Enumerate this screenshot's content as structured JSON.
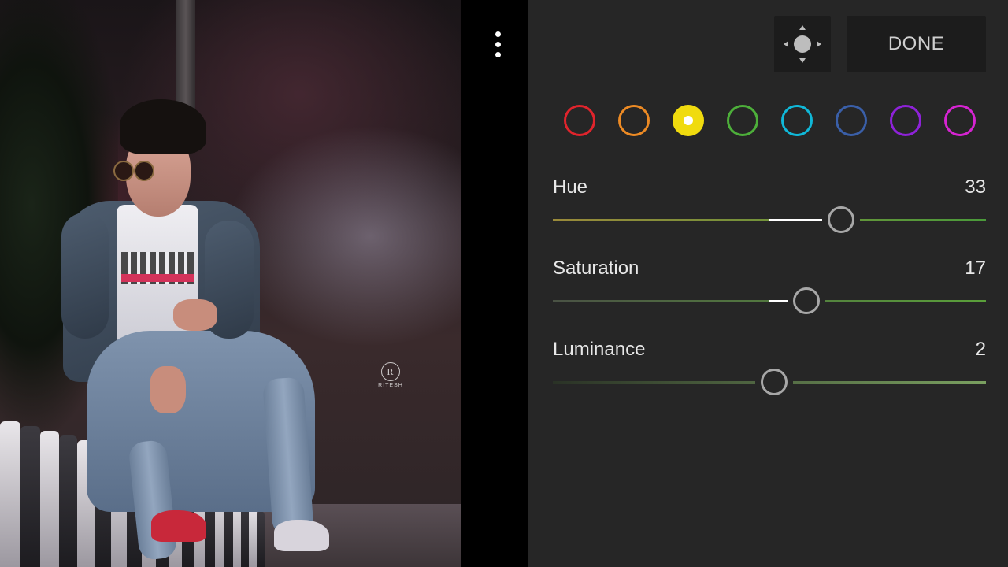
{
  "toolbar": {
    "more_icon": "more-vertical-icon",
    "move_icon": "move-target-icon",
    "done_label": "DONE"
  },
  "photo": {
    "watermark_letter": "R",
    "watermark_text": "RITESH"
  },
  "color_swatches": [
    {
      "name": "red",
      "color": "#e0242c",
      "selected": false
    },
    {
      "name": "orange",
      "color": "#ec8a24",
      "selected": false
    },
    {
      "name": "yellow",
      "color": "#f0db0e",
      "selected": true
    },
    {
      "name": "green",
      "color": "#4daf3a",
      "selected": false
    },
    {
      "name": "aqua",
      "color": "#10b8d8",
      "selected": false
    },
    {
      "name": "blue",
      "color": "#3a5fa8",
      "selected": false
    },
    {
      "name": "purple",
      "color": "#8e22d8",
      "selected": false
    },
    {
      "name": "magenta",
      "color": "#d624d2",
      "selected": false
    }
  ],
  "sliders": {
    "hue": {
      "label": "Hue",
      "value": "33",
      "min": -100,
      "max": 100,
      "num": 33,
      "gradient": [
        "#9a8a3a",
        "#4a9a3a"
      ]
    },
    "saturation": {
      "label": "Saturation",
      "value": "17",
      "min": -100,
      "max": 100,
      "num": 17,
      "gradient": [
        "#4a5244",
        "#5aa03a"
      ]
    },
    "luminance": {
      "label": "Luminance",
      "value": "2",
      "min": -100,
      "max": 100,
      "num": 2,
      "gradient": [
        "#2a3226",
        "#7aa060"
      ]
    }
  }
}
